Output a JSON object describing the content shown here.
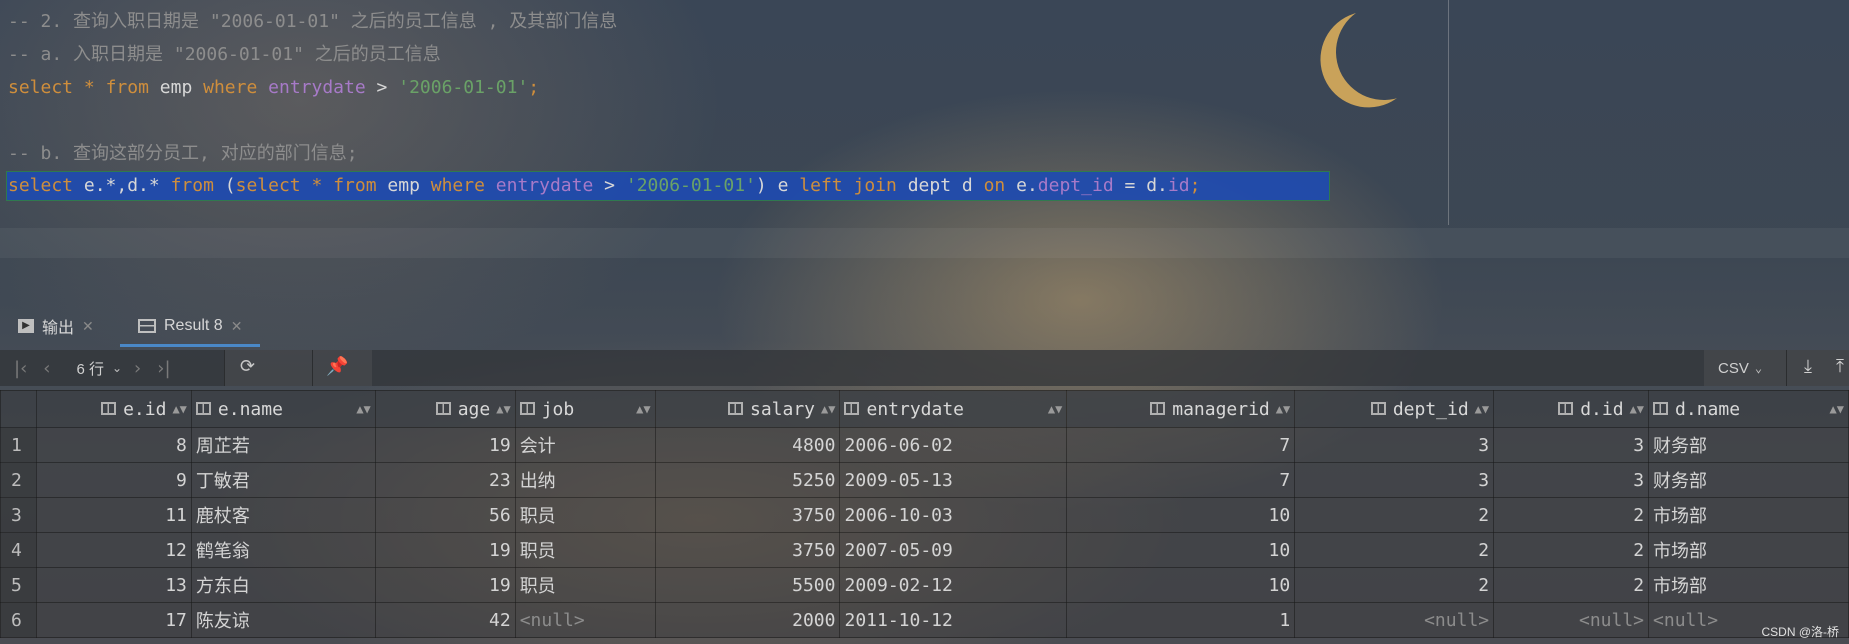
{
  "editor": {
    "comment1": "-- 2. 查询入职日期是 \"2006-01-01\" 之后的员工信息 , 及其部门信息",
    "comment2": "-- a. 入职日期是 \"2006-01-01\" 之后的员工信息",
    "query1": {
      "select": "select",
      "star": "*",
      "from": "from",
      "table": "emp",
      "where": "where",
      "field": "entrydate",
      "op": ">",
      "value": "'2006-01-01'",
      "semi": ";"
    },
    "comment3": "-- b. 查询这部分员工, 对应的部门信息;",
    "query2": {
      "select": "select",
      "cols": "e.*,d.*",
      "from": "from",
      "paren_open": "(",
      "select2": "select",
      "star": "*",
      "from2": "from",
      "table": "emp",
      "where": "where",
      "field": "entrydate",
      "op": ">",
      "value": "'2006-01-01'",
      "paren_close": ")",
      "alias_e": "e",
      "left": "left",
      "join": "join",
      "dept": "dept",
      "alias_d": "d",
      "on": "on",
      "e_prefix": "e.",
      "dept_id": "dept_id",
      "eq": "=",
      "d_prefix": "d.",
      "id": "id",
      "semi": ";"
    }
  },
  "tabs": [
    {
      "label": "输出",
      "icon": "console-icon"
    },
    {
      "label": "Result 8",
      "icon": "table-icon"
    }
  ],
  "toolbar": {
    "rows_label": "6 行",
    "export_format": "CSV"
  },
  "grid": {
    "columns": [
      "e.id",
      "e.name",
      "age",
      "job",
      "salary",
      "entrydate",
      "managerid",
      "dept_id",
      "d.id",
      "d.name"
    ],
    "rows": [
      [
        "1",
        "8",
        "周芷若",
        "19",
        "会计",
        "4800",
        "2006-06-02",
        "7",
        "3",
        "3",
        "财务部"
      ],
      [
        "2",
        "9",
        "丁敏君",
        "23",
        "出纳",
        "5250",
        "2009-05-13",
        "7",
        "3",
        "3",
        "财务部"
      ],
      [
        "3",
        "11",
        "鹿杖客",
        "56",
        "职员",
        "3750",
        "2006-10-03",
        "10",
        "2",
        "2",
        "市场部"
      ],
      [
        "4",
        "12",
        "鹤笔翁",
        "19",
        "职员",
        "3750",
        "2007-05-09",
        "10",
        "2",
        "2",
        "市场部"
      ],
      [
        "5",
        "13",
        "方东白",
        "19",
        "职员",
        "5500",
        "2009-02-12",
        "10",
        "2",
        "2",
        "市场部"
      ],
      [
        "6",
        "17",
        "陈友谅",
        "42",
        "<null>",
        "2000",
        "2011-10-12",
        "1",
        "<null>",
        "<null>",
        "<null>"
      ]
    ]
  },
  "watermark": "CSDN @洛-桥"
}
